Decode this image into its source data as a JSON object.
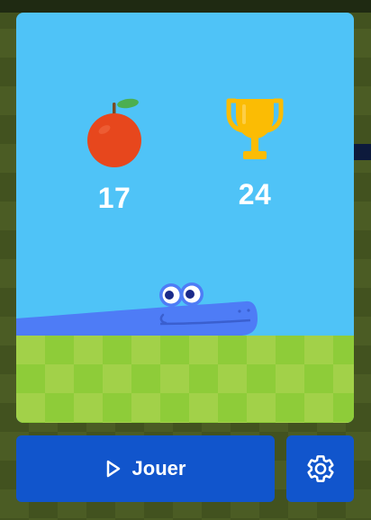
{
  "game": {
    "score": "17",
    "best_score": "24",
    "score_icon": "apple-icon",
    "best_icon": "trophy-icon"
  },
  "controls": {
    "play_label": "Jouer",
    "play_icon": "play-icon",
    "settings_icon": "gear-icon"
  },
  "colors": {
    "sky": "#4fc3f7",
    "grass_light": "#a2d149",
    "grass_dark": "#8ecc39",
    "button": "#1155cc",
    "snake": "#4e7cf6",
    "apple": "#e7471d",
    "trophy": "#fbbc04"
  }
}
